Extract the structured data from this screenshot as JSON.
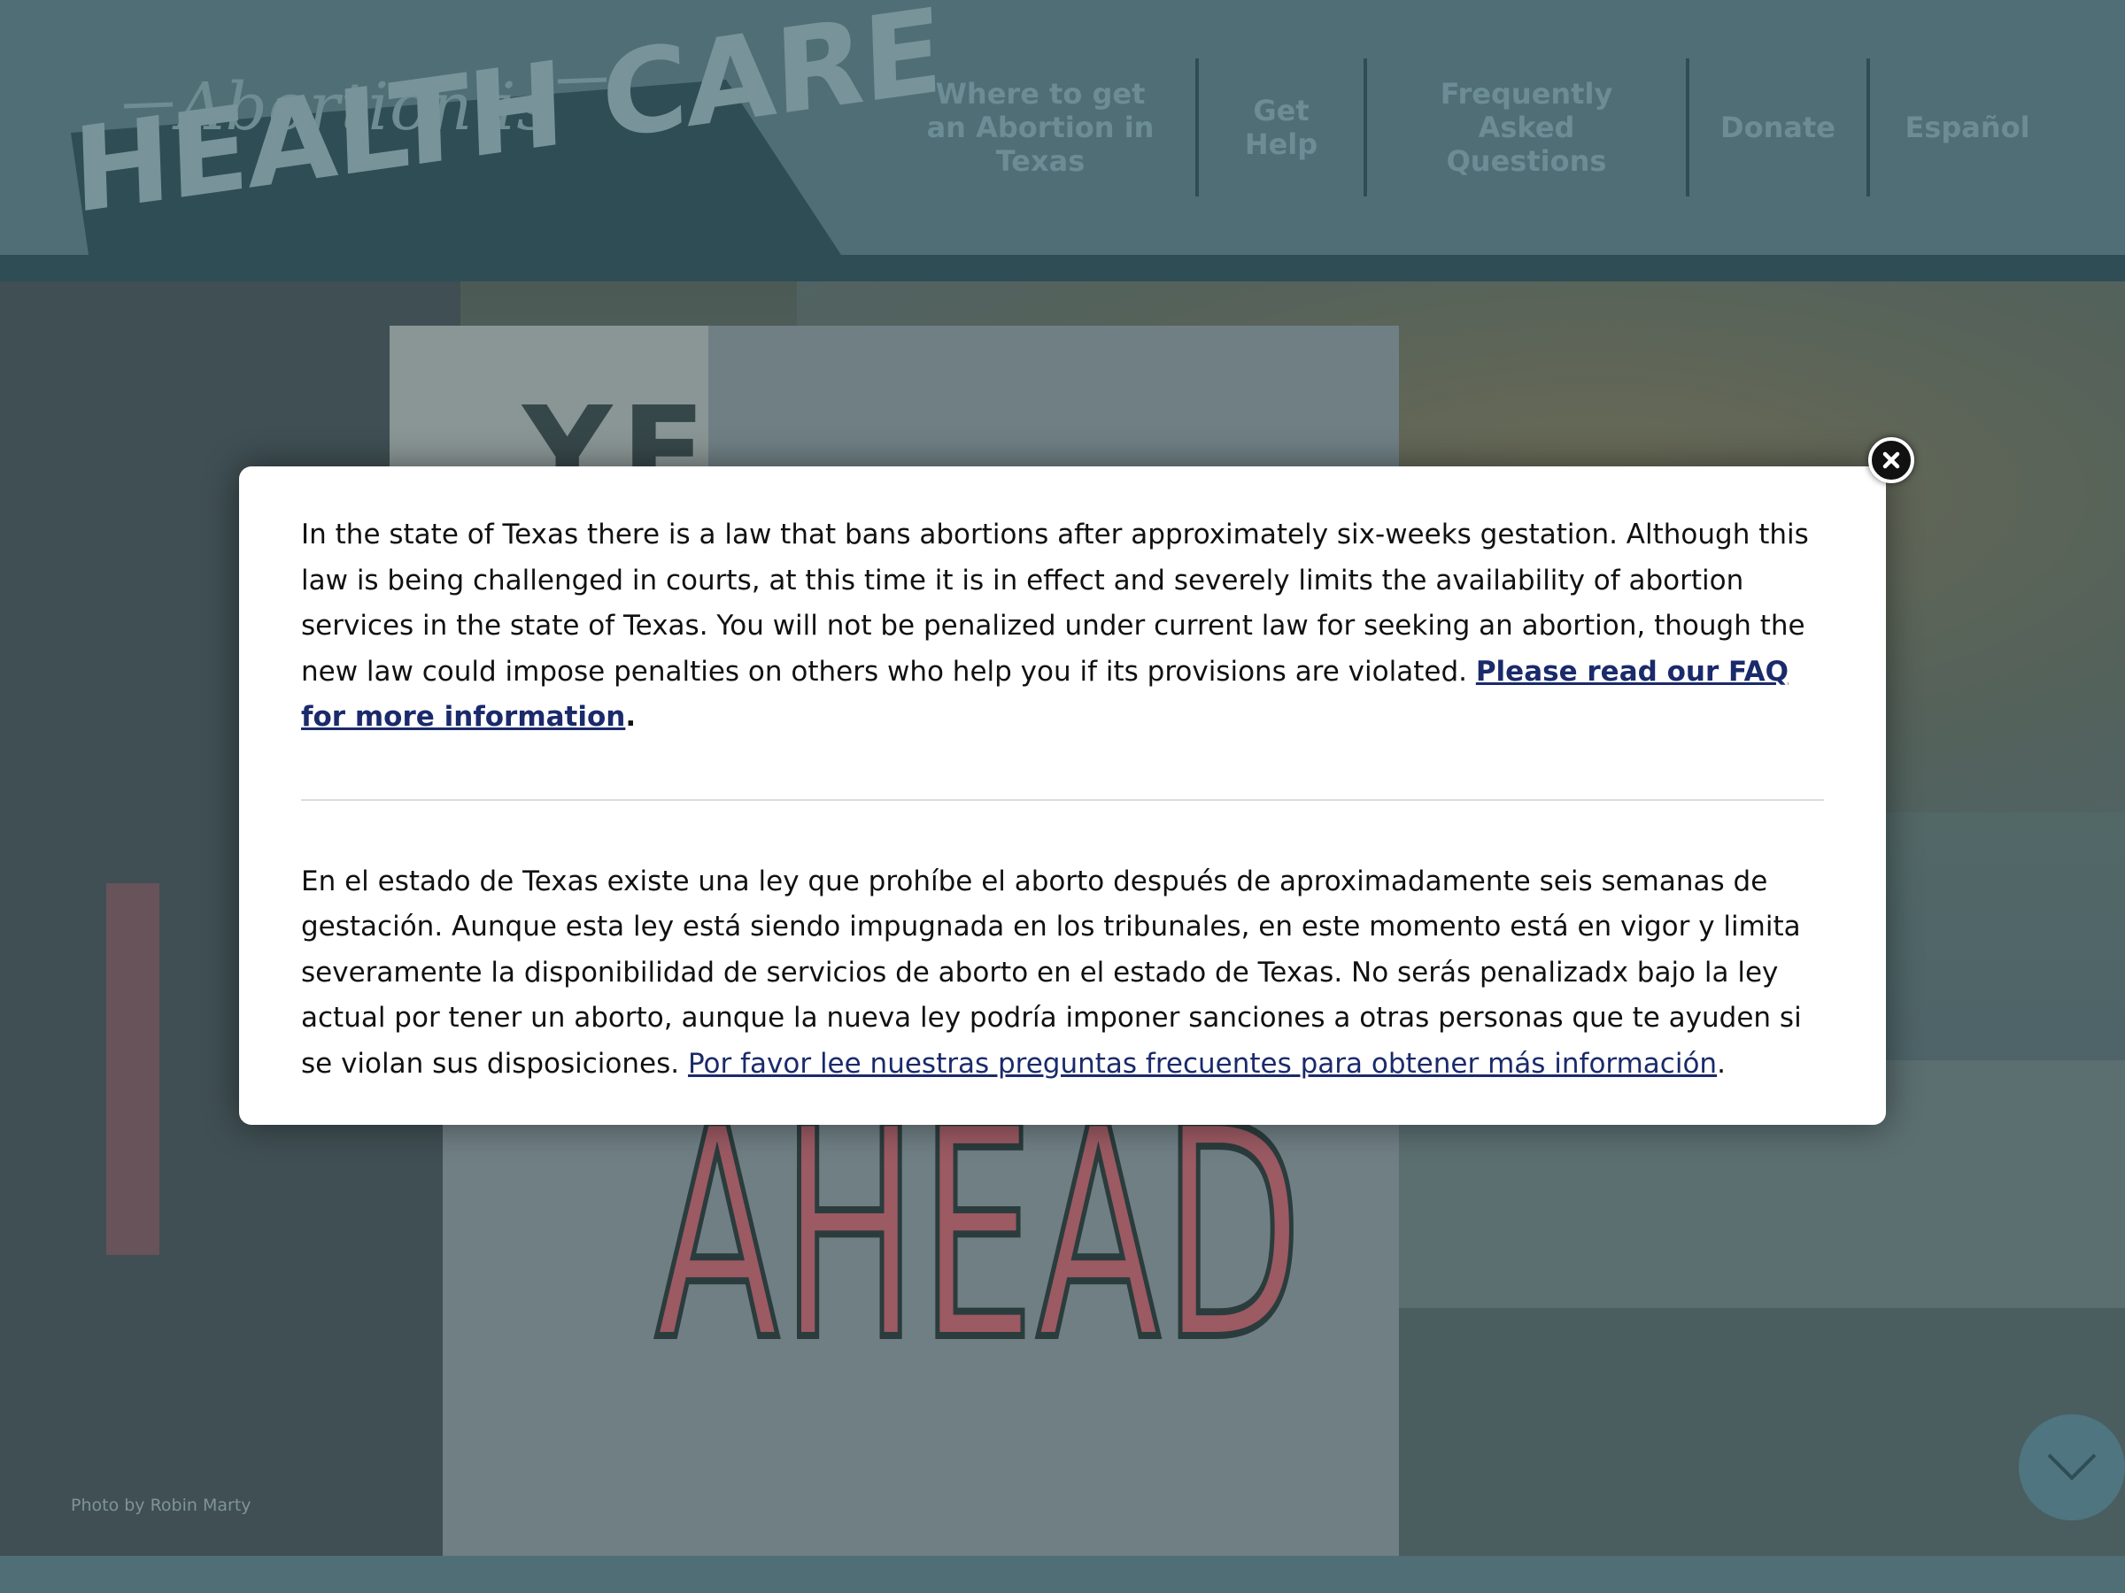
{
  "header": {
    "logo": {
      "tagline": "Abortion is",
      "title": "HEALTH CARE"
    },
    "nav": [
      {
        "label": "Where to get an Abortion in Texas"
      },
      {
        "label": "Get Help"
      },
      {
        "label": "Frequently Asked Questions"
      },
      {
        "label": "Donate"
      },
      {
        "label": "Español"
      }
    ]
  },
  "hero": {
    "sign_text_top": "YE",
    "sign_text": "AHEAD",
    "photo_credit": "Photo by Robin Marty"
  },
  "modal": {
    "english": {
      "text": "In the state of Texas there is a law that bans abortions after approximately six-weeks gestation. Although this law is being challenged in courts, at this time it is in effect and severely limits the availability of abortion services in the state of Texas. You will not be penalized under current law for seeking an abortion, though the new law could impose penalties on others who help you if its provisions are violated. ",
      "link": "Please read our FAQ for more information",
      "suffix": "."
    },
    "spanish": {
      "text": "En el estado de Texas existe una ley que prohíbe el aborto después de aproximadamente seis semanas de gestación. Aunque esta ley está siendo impugnada en los tribunales, en este momento está en vigor y limita severamente la disponibilidad de servicios de aborto en el estado de Texas. No serás penalizadx bajo la ley actual por tener un aborto, aunque la nueva ley podría imponer sanciones a otras personas que te ayuden si se violan sus disposiciones. ",
      "link": "Por favor lee nuestras preguntas frecuentes para obtener más información",
      "suffix": "."
    }
  },
  "colors": {
    "header_bg": "#4f6e76",
    "header_strip": "#2f4d55",
    "nav_text": "#6c8d95",
    "link": "#1a2a6b",
    "modal_bg": "#ffffff"
  },
  "icons": {
    "close": "close-icon",
    "scroll": "chevron-down-icon"
  }
}
